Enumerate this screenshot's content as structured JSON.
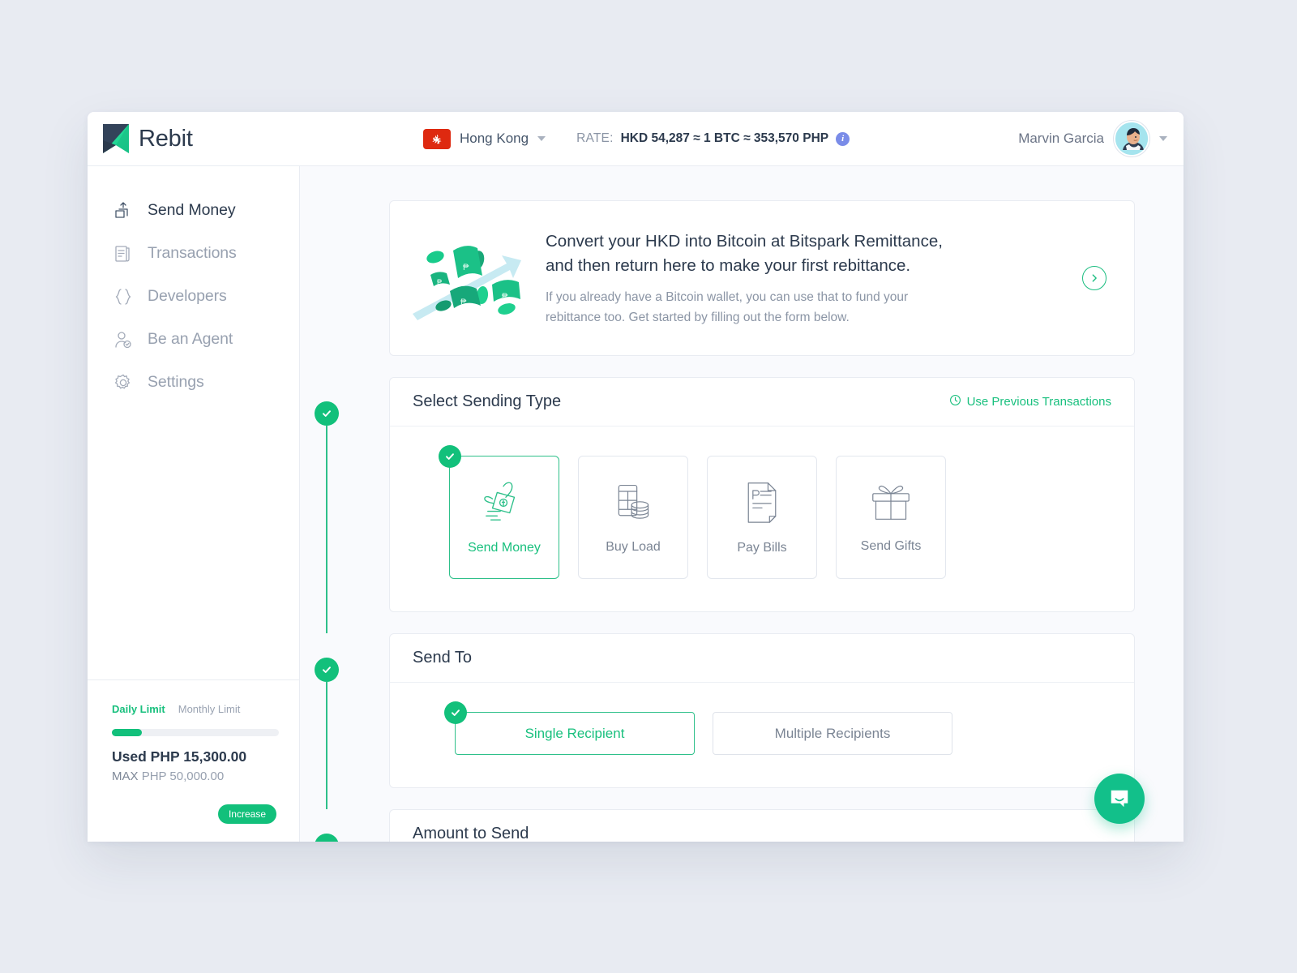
{
  "brand": {
    "name": "Rebit",
    "logo_icon": "rebit-bookmark-logo"
  },
  "topbar": {
    "country": "Hong Kong",
    "flag_icon": "hong-kong-flag-icon",
    "country_caret_icon": "chevron-down-icon",
    "rate_label": "RATE:",
    "rate_value": "HKD 54,287 ≈ 1 BTC ≈ 353,570 PHP",
    "info_icon": "info-icon",
    "user_name": "Marvin Garcia",
    "avatar_icon": "user-avatar",
    "user_caret_icon": "chevron-down-icon"
  },
  "sidebar": {
    "items": [
      {
        "label": "Send Money",
        "icon": "send-money-icon",
        "active": true
      },
      {
        "label": "Transactions",
        "icon": "transactions-icon",
        "active": false
      },
      {
        "label": "Developers",
        "icon": "developers-braces-icon",
        "active": false
      },
      {
        "label": "Be an Agent",
        "icon": "be-an-agent-icon",
        "active": false
      },
      {
        "label": "Settings",
        "icon": "gear-icon",
        "active": false
      }
    ],
    "limits": {
      "tab_daily": "Daily Limit",
      "tab_monthly": "Monthly Limit",
      "progress_percent": 18,
      "used_label": "Used",
      "used_value": "PHP 15,300.00",
      "max_label": "MAX",
      "max_value": "PHP 50,000.00",
      "increase_button": "Increase"
    }
  },
  "banner": {
    "art_icon": "money-flying-arrow-illustration",
    "title_line1": "Convert your HKD into Bitcoin at Bitspark Remittance,",
    "title_line2": "and then return here to make your first rebittance.",
    "sub_line1": "If you already have a Bitcoin wallet, you can use that to fund your",
    "sub_line2": "rebittance too. Get started by filling out the form below.",
    "next_icon": "chevron-right-icon"
  },
  "steps": {
    "sending_type": {
      "title": "Select Sending Type",
      "prev_link": "Use Previous Transactions",
      "prev_link_icon": "clock-icon",
      "bullet_icon": "check-icon",
      "tiles": [
        {
          "label": "Send Money",
          "icon": "hand-holding-money-icon",
          "selected": true
        },
        {
          "label": "Buy Load",
          "icon": "phone-coins-icon",
          "selected": false
        },
        {
          "label": "Pay Bills",
          "icon": "bill-document-icon",
          "selected": false
        },
        {
          "label": "Send Gifts",
          "icon": "gift-box-icon",
          "selected": false
        }
      ]
    },
    "send_to": {
      "title": "Send To",
      "bullet_icon": "check-icon",
      "options": [
        {
          "label": "Single Recipient",
          "selected": true
        },
        {
          "label": "Multiple Recipients",
          "selected": false
        }
      ]
    },
    "amount_to_send": {
      "title": "Amount to Send",
      "bullet_icon": "check-icon"
    }
  },
  "chat": {
    "icon": "chat-bubble-smile-icon"
  },
  "colors": {
    "page_background": "#e8ebf2",
    "accent_green": "#12c07b",
    "accent_green_text": "#19c07e",
    "text_dark": "#2c3a4d",
    "text_muted": "#8b95a5",
    "flag_red": "#de2910",
    "info_blue": "#7a8ce8"
  }
}
